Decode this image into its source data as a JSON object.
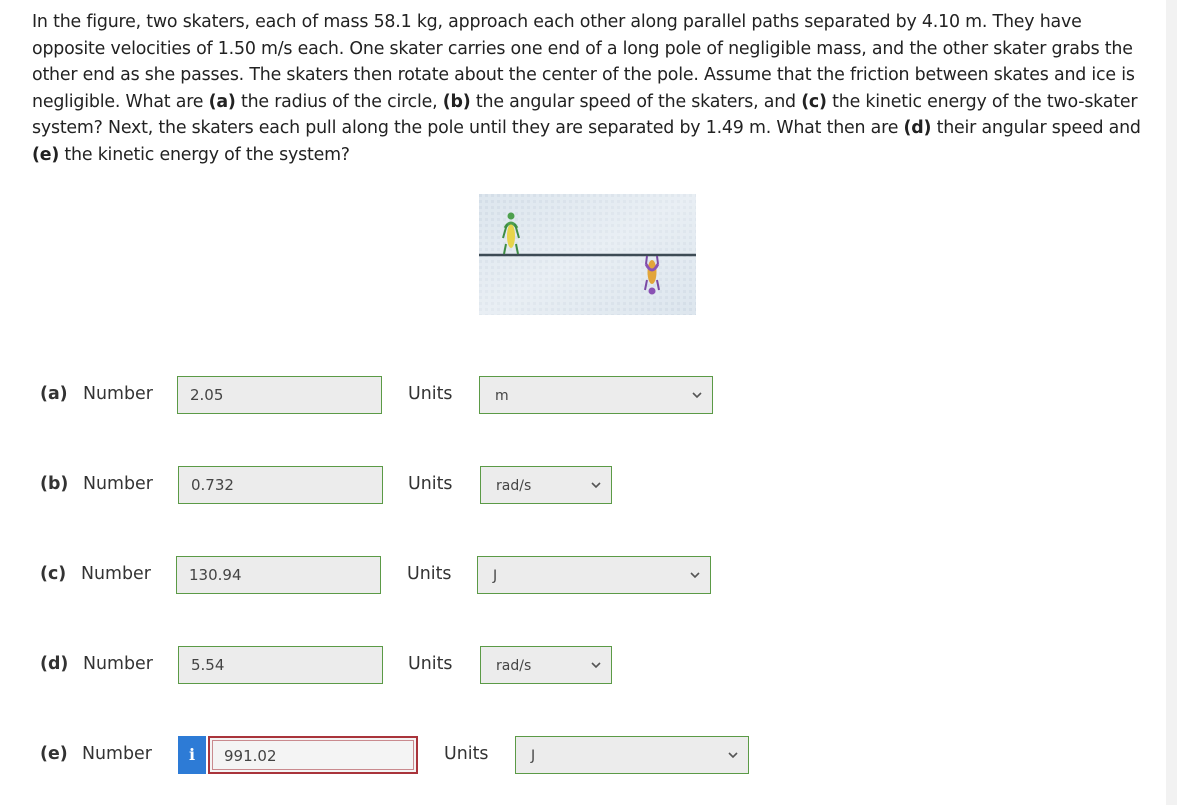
{
  "question": {
    "segments": [
      {
        "text": "In the figure, two skaters, each of mass 58.1 kg, approach each other along parallel paths separated by 4.10 m. They have opposite velocities of 1.50 m/s each. One skater carries one end of a long pole of negligible mass, and the other skater grabs the other end as she passes. The skaters then rotate about the center of the pole. Assume that the friction between skates and ice is negligible. What are ",
        "bold": false
      },
      {
        "text": "(a)",
        "bold": true
      },
      {
        "text": " the radius of the circle, ",
        "bold": false
      },
      {
        "text": "(b)",
        "bold": true
      },
      {
        "text": " the angular speed of the skaters, and ",
        "bold": false
      },
      {
        "text": "(c)",
        "bold": true
      },
      {
        "text": " the kinetic energy of the two-skater system? Next, the skaters each pull along the pole until they are separated by 1.49 m. What then are ",
        "bold": false
      },
      {
        "text": "(d)",
        "bold": true
      },
      {
        "text": " their angular speed and ",
        "bold": false
      },
      {
        "text": "(e)",
        "bold": true
      },
      {
        "text": " the kinetic energy of the system?",
        "bold": false
      }
    ]
  },
  "number_label": "Number",
  "units_label": "Units",
  "answers": [
    {
      "part": "(a)",
      "value": "2.05",
      "unit": "m"
    },
    {
      "part": "(b)",
      "value": "0.732",
      "unit": "rad/s"
    },
    {
      "part": "(c)",
      "value": "130.94",
      "unit": "J"
    },
    {
      "part": "(d)",
      "value": "5.54",
      "unit": "rad/s"
    },
    {
      "part": "(e)",
      "value": "991.02",
      "unit": "J",
      "info_icon": "i"
    }
  ],
  "colors": {
    "field_border": "#5b9a46",
    "error_border": "#a9343b",
    "info_button": "#2d7bd6"
  }
}
